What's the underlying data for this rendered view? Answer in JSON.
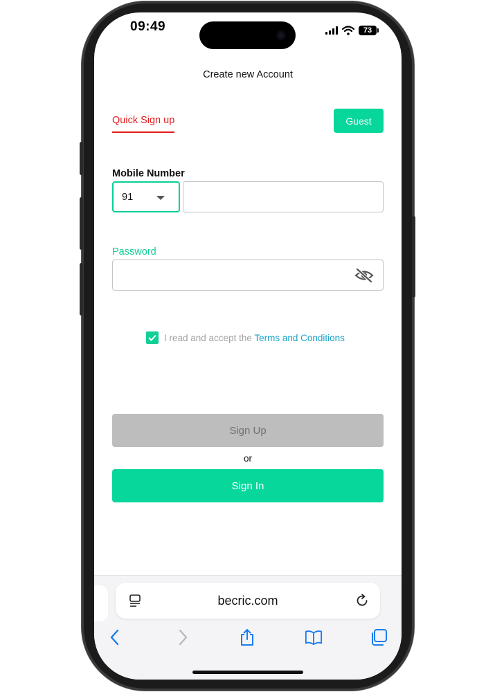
{
  "status_bar": {
    "time": "09:49",
    "battery": "73"
  },
  "header": {
    "title": "Create new Account"
  },
  "tabs": {
    "quick_signup": "Quick Sign up",
    "guest": "Guest"
  },
  "form": {
    "mobile_label": "Mobile Number",
    "country_code": "91",
    "mobile_value": "",
    "password_label": "Password",
    "password_value": ""
  },
  "terms": {
    "prefix": "I read and accept the ",
    "link": "Terms and Conditions",
    "checked": true
  },
  "buttons": {
    "signup": "Sign Up",
    "or": "or",
    "signin": "Sign In"
  },
  "browser": {
    "url": "becric.com"
  },
  "colors": {
    "accent": "#07d79a",
    "tab_active": "#e31b1b",
    "link": "#1aa3c8",
    "disabled": "#bdbdbd",
    "ios_blue": "#1a7df0"
  },
  "icons": [
    "eye-off-icon",
    "checkbox-check-icon",
    "reader-icon",
    "reload-icon",
    "back-icon",
    "forward-icon",
    "share-icon",
    "bookmarks-icon",
    "tabs-icon"
  ]
}
